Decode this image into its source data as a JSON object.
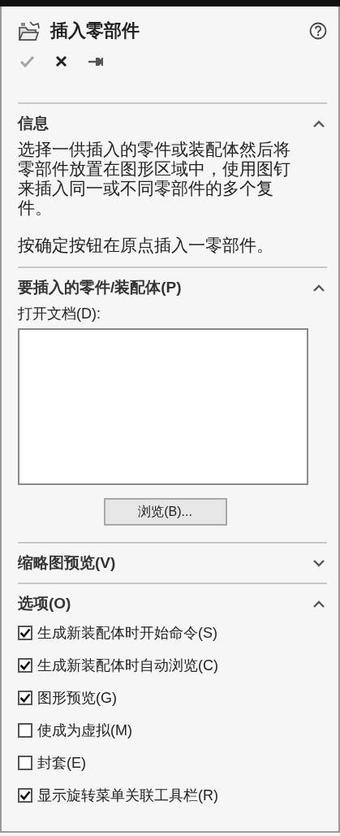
{
  "panel": {
    "title": "插入零部件",
    "actions": [
      {
        "kind": "ok",
        "disabled": true
      },
      {
        "kind": "cancel",
        "disabled": false
      },
      {
        "kind": "pin",
        "disabled": false
      }
    ],
    "sections": [
      {
        "kind": "info",
        "title": "信息",
        "expanded": true,
        "paragraphs": [
          "选择一供插入的零件或装配体然后将零部件放置在图形区域中，使用图钉来插入同一或不同零部件的多个复件。",
          "按确定按钮在原点插入一零部件。"
        ]
      },
      {
        "kind": "parts",
        "title": "要插入的零件/装配体(P)",
        "expanded": true,
        "field_label": "打开文档(D):",
        "button": "浏览(B)..."
      },
      {
        "kind": "thumbnail",
        "title": "缩略图预览(V)",
        "expanded": false
      },
      {
        "kind": "options",
        "title": "选项(O)",
        "expanded": true,
        "options": [
          {
            "label": "生成新装配体时开始命令(S)",
            "checked": true
          },
          {
            "label": "生成新装配体时自动浏览(C)",
            "checked": true
          },
          {
            "label": "图形预览(G)",
            "checked": true
          },
          {
            "label": "使成为虚拟(M)",
            "checked": false
          },
          {
            "label": "封套(E)",
            "checked": false
          },
          {
            "label": "显示旋转菜单关联工具栏(R)",
            "checked": true
          }
        ]
      }
    ]
  }
}
